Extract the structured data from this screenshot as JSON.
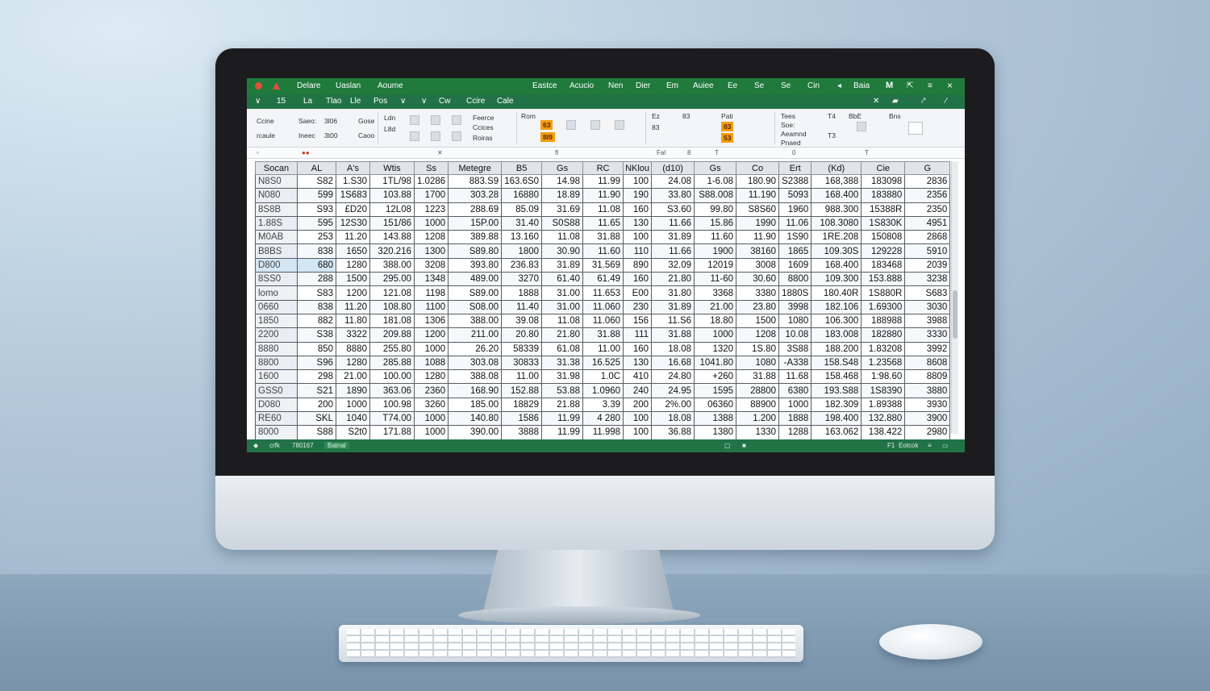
{
  "titlebar": {
    "left": [
      "Delare",
      "Uaslan",
      "Aoume"
    ],
    "right": [
      "Eastce",
      "Acucio",
      "Nen",
      "Dier",
      "Em",
      "Auiee",
      "Ee",
      "Se",
      "Se",
      "Cin",
      "Baia",
      "M"
    ],
    "close": "×"
  },
  "tabs": [
    "15",
    "La",
    "Tlao",
    "Lle",
    "Pos",
    "Cw",
    "Ccire",
    "Cale"
  ],
  "ribbon": {
    "labels": [
      "Ccine",
      "Saeo:",
      "3l06",
      "Gose",
      "Ldn",
      "Feerce",
      "Ccices",
      "Roiras",
      "Rom",
      "Ez",
      "83",
      "Pati",
      "Tees",
      "Soe:",
      "Aeamnd",
      "Pnaed",
      "BbE",
      "Bns",
      "T4",
      "T3",
      "Caoo",
      "rcaule",
      "Ineec",
      "3t00",
      "L8d"
    ],
    "highlights": [
      "63",
      "8l9",
      "83",
      "53"
    ]
  },
  "formula_bar": [
    "fl",
    "Fal",
    "8",
    "T",
    "0",
    "T"
  ],
  "grid": {
    "headers": [
      "Socan",
      "AL",
      "A's",
      "Wtis",
      "Ss",
      "Metegre",
      "B5",
      "Gs",
      "RC",
      "NKlou",
      "(d10)",
      "Gs",
      "Co",
      "Ert",
      "(Kd)",
      "Cie",
      "G"
    ],
    "rows": [
      [
        "N8S0",
        "S82",
        "1.S30",
        "1TL/98",
        "1.0286",
        "883.S9",
        "163.6S0",
        "14.98",
        "11.99",
        "100",
        "24.08",
        "1-6.08",
        "180.90",
        "S2388",
        "168,388",
        "183098",
        "2836"
      ],
      [
        "N080",
        "599",
        "1S683",
        "103.88",
        "1700",
        "303.28",
        "16880",
        "18.89",
        "11.90",
        "190",
        "33.80",
        "S88.008",
        "11.190",
        "5093",
        "168.400",
        "183880",
        "2356"
      ],
      [
        "8S8B",
        "S93",
        "£D20",
        "12L08",
        "1223",
        "288.69",
        "85.09",
        "31.69",
        "11.08",
        "160",
        "S3.60",
        "99.80",
        "S8S60",
        "1960",
        "988.300",
        "15388R",
        "2350"
      ],
      [
        "1.88S",
        "595",
        "12S30",
        "151/86",
        "1000",
        "15P.00",
        "31.40",
        "S0S88",
        "11.65",
        "130",
        "11.66",
        "15.86",
        "1990",
        "11.06",
        "108.3080",
        "1S830K",
        "4951"
      ],
      [
        "M0AB",
        "253",
        "11.20",
        "143.88",
        "1208",
        "389.88",
        "13.160",
        "11.08",
        "31.88",
        "100",
        "31.89",
        "11.60",
        "11.90",
        "1S90",
        "1RE.208",
        "150808",
        "2868"
      ],
      [
        "B8BS",
        "838",
        "1650",
        "320.216",
        "1300",
        "S89.80",
        "1800",
        "30.90",
        "11.60",
        "110",
        "11.66",
        "1900",
        "38160",
        "1865",
        "109.30S",
        "129228",
        "5910"
      ],
      [
        "D800",
        "680",
        "1280",
        "388.00",
        "3208",
        "393.80",
        "236.83",
        "31.89",
        "31.569",
        "890",
        "32.09",
        "12019",
        "3008",
        "1609",
        "168.400",
        "183468",
        "2039"
      ],
      [
        "8SS0",
        "288",
        "1500",
        "295.00",
        "1348",
        "489.00",
        "3270",
        "61.40",
        "61.49",
        "160",
        "21.80",
        "11-60",
        "30.60",
        "8800",
        "109.300",
        "153.888",
        "3238"
      ],
      [
        "lomo",
        "S83",
        "1200",
        "121.08",
        "1198",
        "S89.00",
        "1888",
        "31.00",
        "11.653",
        "E00",
        "31.80",
        "3368",
        "3380",
        "1880S",
        "180.40R",
        "1S880R",
        "S683"
      ],
      [
        "0660",
        "838",
        "11.20",
        "108.80",
        "1100",
        "S08.00",
        "11.40",
        "31.00",
        "11.060",
        "230",
        "31.89",
        "21.00",
        "23.80",
        "3998",
        "182.106",
        "1.69300",
        "3030"
      ],
      [
        "1850",
        "882",
        "11.80",
        "181.08",
        "1306",
        "388.00",
        "39.08",
        "11.08",
        "11.060",
        "156",
        "11.S6",
        "18.80",
        "1500",
        "1080",
        "106.300",
        "188988",
        "3988"
      ],
      [
        "2200",
        "S38",
        "3322",
        "209.88",
        "1200",
        "211.00",
        "20.80",
        "21.80",
        "31.88",
        "111",
        "31.88",
        "1000",
        "1208",
        "10.08",
        "183.008",
        "182880",
        "3330"
      ],
      [
        "8880",
        "850",
        "8880",
        "255.80",
        "1000",
        "26.20",
        "58339",
        "61.08",
        "11.00",
        "160",
        "18.08",
        "1320",
        "1S.80",
        "3S88",
        "188.200",
        "1.83208",
        "3992"
      ],
      [
        "8800",
        "S96",
        "1280",
        "285.88",
        "1088",
        "303.08",
        "30833",
        "31.38",
        "16.525",
        "130",
        "16.68",
        "1041.80",
        "1080",
        "-A338",
        "158.S48",
        "1.23568",
        "8608"
      ],
      [
        "1600",
        "298",
        "21.00",
        "100.00",
        "1280",
        "388.08",
        "11.00",
        "31.98",
        "1.0C",
        "410",
        "24.80",
        "+260",
        "31.88",
        "11.68",
        "158.468",
        "1:98.60",
        "8809"
      ],
      [
        "GSS0",
        "S21",
        "1890",
        "363.06",
        "2360",
        "168.90",
        "152.88",
        "53.88",
        "1.0960",
        "240",
        "24.95",
        "1595",
        "28800",
        "6380",
        "193.S88",
        "1S8390",
        "3880"
      ],
      [
        "D080",
        "200",
        "1000",
        "100.98",
        "3260",
        "185.00",
        "18829",
        "21.88",
        "3.39",
        "200",
        "2%.00",
        "06360",
        "88900",
        "1000",
        "182.309",
        "1.89388",
        "3930"
      ],
      [
        "RE60",
        "SKL",
        "1040",
        "T74.00",
        "1000",
        "140.80",
        "1586",
        "11.99",
        "4 280",
        "100",
        "18.08",
        "1388",
        "1.200",
        "1888",
        "198.400",
        "132.880",
        "3900"
      ],
      [
        "8000",
        "S88",
        "S2t0",
        "171.88",
        "1000",
        "390.00",
        "3888",
        "11.99",
        "11.998",
        "100",
        "36.88",
        "1380",
        "1330",
        "1288",
        "163.062",
        "138.422",
        "2980"
      ]
    ]
  },
  "statusbar": {
    "left": [
      "crfk",
      "780167",
      "Batnal"
    ],
    "right": [
      "F1",
      "Eotcok"
    ]
  },
  "colors": {
    "excel_green": "#217346",
    "title_green": "#1f7a3c",
    "highlight_orange": "#f39c12"
  }
}
